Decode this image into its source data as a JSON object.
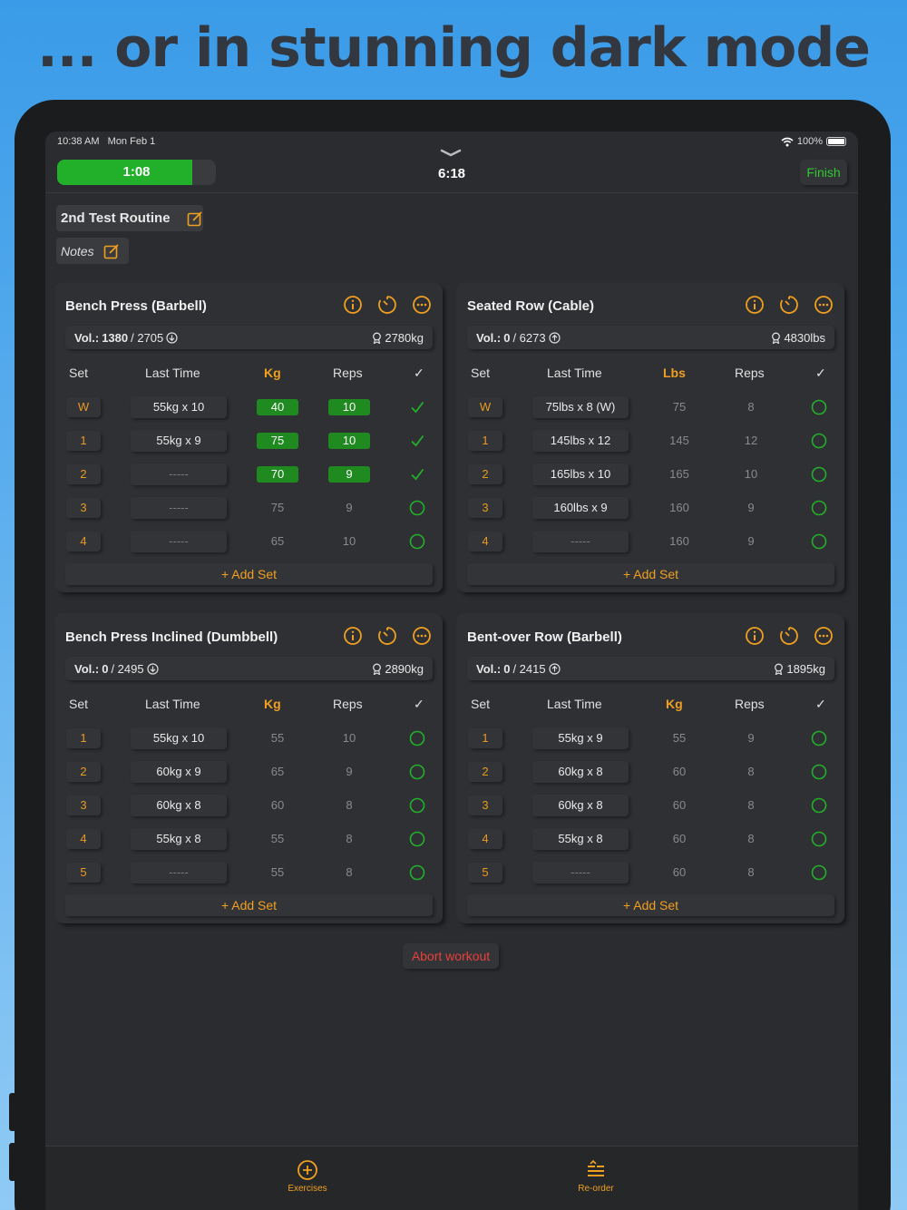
{
  "headline": "... or in stunning dark mode",
  "status": {
    "time": "10:38 AM",
    "date": "Mon Feb 1",
    "battery": "100%"
  },
  "workout": {
    "rest_timer": "1:08",
    "rest_progress": 0.85,
    "elapsed": "6:18",
    "finish_label": "Finish",
    "routine_name": "2nd Test Routine",
    "notes_label": "Notes",
    "abort_label": "Abort workout"
  },
  "colors": {
    "accent": "#f0a020",
    "green": "#22b02a",
    "red": "#e8403a"
  },
  "exercises": [
    {
      "name": "Bench Press (Barbell)",
      "vol_label": "Vol.:",
      "vol_done": "1380",
      "vol_total": "/ 2705",
      "vol_icon": "arrow-down-circle-icon",
      "pr": "2780kg",
      "headers": {
        "set": "Set",
        "last": "Last Time",
        "unit": "Kg",
        "reps": "Reps"
      },
      "add_label": "+ Add Set",
      "rows": [
        {
          "set": "W",
          "last": "55kg x 10",
          "weight": "40",
          "reps": "10",
          "done": true
        },
        {
          "set": "1",
          "last": "55kg x 9",
          "weight": "75",
          "reps": "10",
          "done": true
        },
        {
          "set": "2",
          "last": "-----",
          "weight": "70",
          "reps": "9",
          "done": true
        },
        {
          "set": "3",
          "last": "-----",
          "weight": "75",
          "reps": "9",
          "done": false
        },
        {
          "set": "4",
          "last": "-----",
          "weight": "65",
          "reps": "10",
          "done": false
        }
      ]
    },
    {
      "name": "Seated Row (Cable)",
      "vol_label": "Vol.:",
      "vol_done": "0",
      "vol_total": "/ 6273",
      "vol_icon": "arrow-up-circle-icon",
      "pr": "4830lbs",
      "headers": {
        "set": "Set",
        "last": "Last Time",
        "unit": "Lbs",
        "reps": "Reps"
      },
      "add_label": "+ Add Set",
      "rows": [
        {
          "set": "W",
          "last": "75lbs x 8 (W)",
          "weight": "75",
          "reps": "8",
          "done": false
        },
        {
          "set": "1",
          "last": "145lbs x 12",
          "weight": "145",
          "reps": "12",
          "done": false
        },
        {
          "set": "2",
          "last": "165lbs x 10",
          "weight": "165",
          "reps": "10",
          "done": false
        },
        {
          "set": "3",
          "last": "160lbs x 9",
          "weight": "160",
          "reps": "9",
          "done": false
        },
        {
          "set": "4",
          "last": "-----",
          "weight": "160",
          "reps": "9",
          "done": false
        }
      ]
    },
    {
      "name": "Bench Press Inclined (Dumbbell)",
      "vol_label": "Vol.:",
      "vol_done": "0",
      "vol_total": "/ 2495",
      "vol_icon": "arrow-down-circle-icon",
      "pr": "2890kg",
      "headers": {
        "set": "Set",
        "last": "Last Time",
        "unit": "Kg",
        "reps": "Reps"
      },
      "add_label": "+ Add Set",
      "rows": [
        {
          "set": "1",
          "last": "55kg x 10",
          "weight": "55",
          "reps": "10",
          "done": false
        },
        {
          "set": "2",
          "last": "60kg x 9",
          "weight": "65",
          "reps": "9",
          "done": false
        },
        {
          "set": "3",
          "last": "60kg x 8",
          "weight": "60",
          "reps": "8",
          "done": false
        },
        {
          "set": "4",
          "last": "55kg x 8",
          "weight": "55",
          "reps": "8",
          "done": false
        },
        {
          "set": "5",
          "last": "-----",
          "weight": "55",
          "reps": "8",
          "done": false
        }
      ]
    },
    {
      "name": "Bent-over Row (Barbell)",
      "vol_label": "Vol.:",
      "vol_done": "0",
      "vol_total": "/ 2415",
      "vol_icon": "arrow-up-circle-icon",
      "pr": "1895kg",
      "headers": {
        "set": "Set",
        "last": "Last Time",
        "unit": "Kg",
        "reps": "Reps"
      },
      "add_label": "+ Add Set",
      "rows": [
        {
          "set": "1",
          "last": "55kg x 9",
          "weight": "55",
          "reps": "9",
          "done": false
        },
        {
          "set": "2",
          "last": "60kg x 8",
          "weight": "60",
          "reps": "8",
          "done": false
        },
        {
          "set": "3",
          "last": "60kg x 8",
          "weight": "60",
          "reps": "8",
          "done": false
        },
        {
          "set": "4",
          "last": "55kg x 8",
          "weight": "60",
          "reps": "8",
          "done": false
        },
        {
          "set": "5",
          "last": "-----",
          "weight": "60",
          "reps": "8",
          "done": false
        }
      ]
    }
  ],
  "tabs": [
    {
      "label": "Exercises",
      "icon": "plus-circle-icon"
    },
    {
      "label": "Re-order",
      "icon": "reorder-icon"
    }
  ]
}
